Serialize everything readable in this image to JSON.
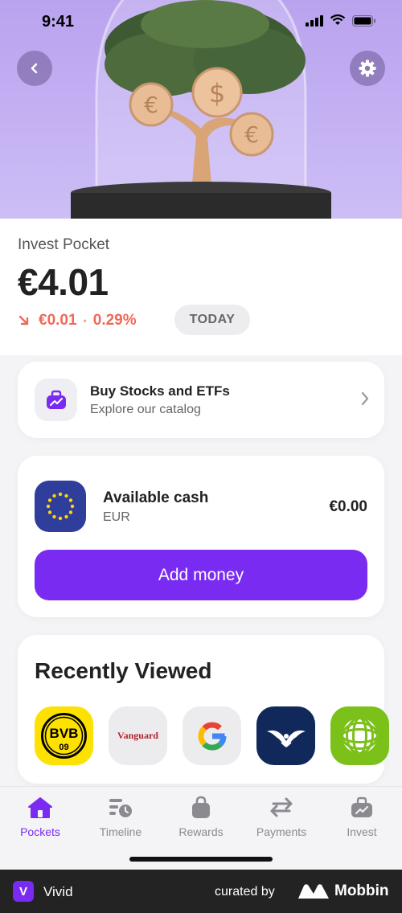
{
  "status_bar": {
    "time": "9:41"
  },
  "hero": {
    "back_icon": "chevron-left-icon",
    "settings_icon": "gear-icon"
  },
  "summary": {
    "title": "Invest Pocket",
    "balance": "€4.01",
    "change_amount": "€0.01",
    "separator": "•",
    "change_percent": "0.29%",
    "period": "TODAY"
  },
  "catalog": {
    "title": "Buy Stocks and ETFs",
    "subtitle": "Explore our catalog"
  },
  "cash": {
    "title": "Available cash",
    "currency": "EUR",
    "amount": "€0.00",
    "button": "Add money"
  },
  "recent": {
    "title": "Recently Viewed",
    "items": [
      {
        "name": "BVB",
        "label": "BVB",
        "sublabel": "09",
        "color": "#fde100"
      },
      {
        "name": "Vanguard",
        "label": "Vanguard",
        "color": "#e9e9ec"
      },
      {
        "name": "Google",
        "label": "G",
        "color": "#e9e9ec"
      },
      {
        "name": "Eagle",
        "color": "#10285a"
      },
      {
        "name": "Globe",
        "color": "#7cc11a"
      }
    ]
  },
  "tabs": [
    {
      "label": "Pockets",
      "icon": "home-icon",
      "active": true
    },
    {
      "label": "Timeline",
      "icon": "timeline-icon",
      "active": false
    },
    {
      "label": "Rewards",
      "icon": "bag-icon",
      "active": false
    },
    {
      "label": "Payments",
      "icon": "arrows-icon",
      "active": false
    },
    {
      "label": "Invest",
      "icon": "invest-icon",
      "active": false
    }
  ],
  "footer": {
    "app_badge": "V",
    "app_name": "Vivid",
    "curated_by": "curated by",
    "brand": "Mobbin"
  },
  "colors": {
    "accent": "#7a2bf1",
    "negative": "#ee6a57",
    "hero_bg": "#c4b1f3"
  }
}
